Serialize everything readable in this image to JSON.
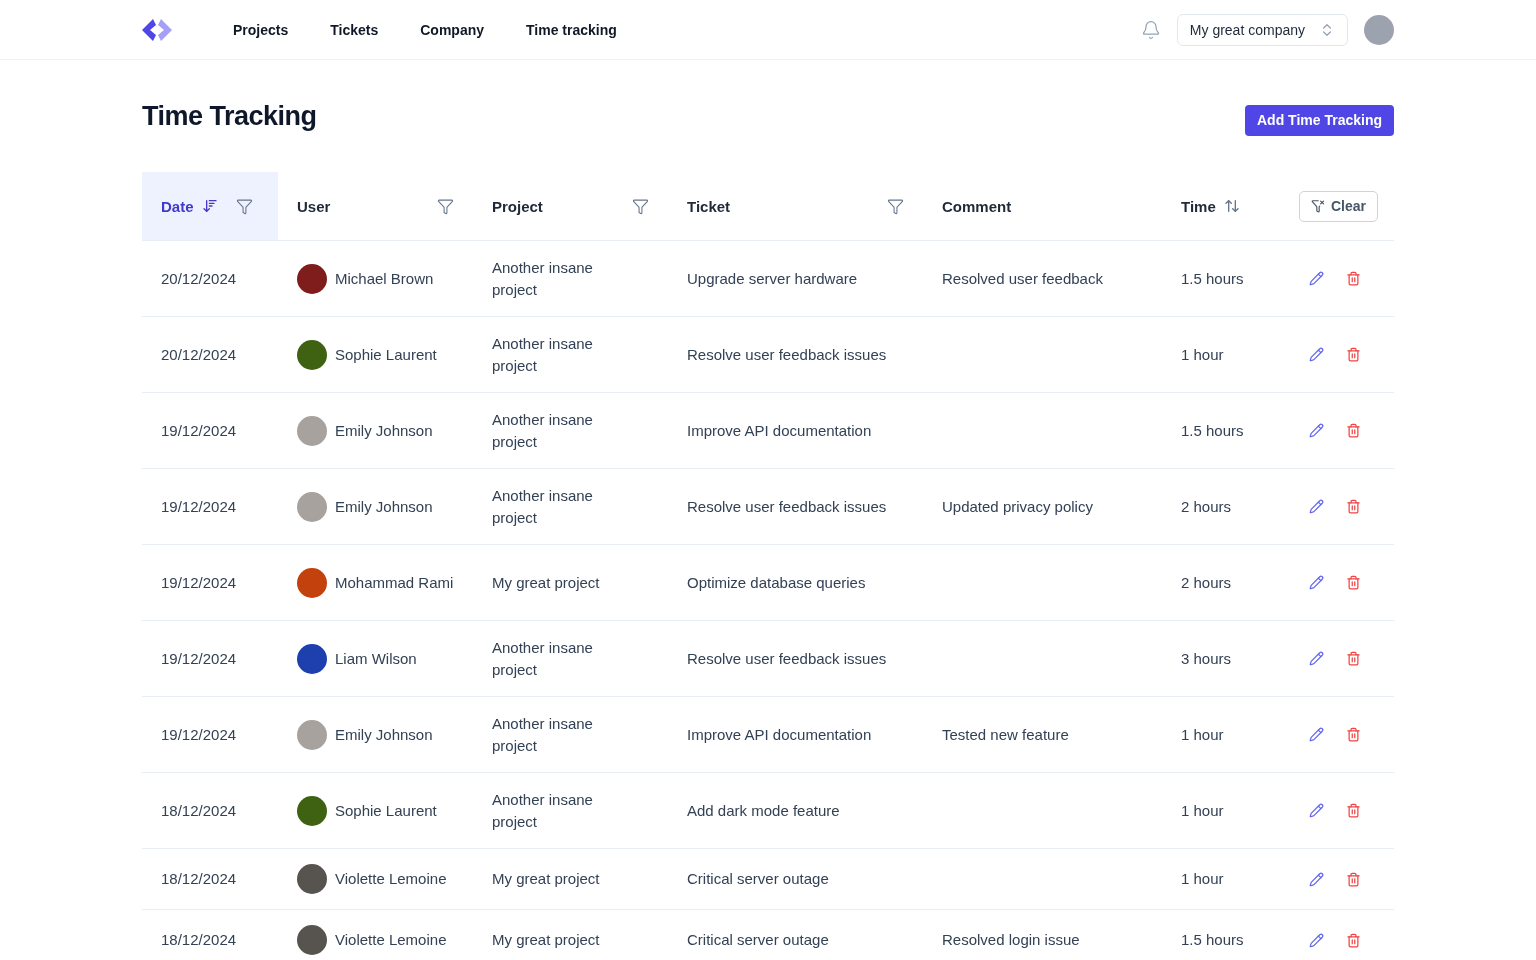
{
  "nav": {
    "items": [
      {
        "label": "Projects"
      },
      {
        "label": "Tickets"
      },
      {
        "label": "Company"
      },
      {
        "label": "Time tracking"
      }
    ],
    "company_select": {
      "value": "My great company"
    }
  },
  "page": {
    "title": "Time Tracking",
    "add_button": "Add Time Tracking"
  },
  "table": {
    "columns": [
      {
        "label": "Date",
        "selected": true,
        "sortable": true,
        "sorted": true,
        "filter": true
      },
      {
        "label": "User",
        "selected": false,
        "sortable": false,
        "filter": true
      },
      {
        "label": "Project",
        "selected": false,
        "sortable": false,
        "filter": true
      },
      {
        "label": "Ticket",
        "selected": false,
        "sortable": false,
        "filter": true
      },
      {
        "label": "Comment",
        "selected": false,
        "sortable": false,
        "filter": false
      },
      {
        "label": "Time",
        "selected": false,
        "sortable": true,
        "sorted": false,
        "filter": false
      }
    ],
    "clear_button": "Clear",
    "rows": [
      {
        "date": "20/12/2024",
        "user": "Michael Brown",
        "project": "Another insane project",
        "ticket": "Upgrade server hardware",
        "comment": "Resolved user feedback",
        "time": "1.5 hours"
      },
      {
        "date": "20/12/2024",
        "user": "Sophie Laurent",
        "project": "Another insane project",
        "ticket": "Resolve user feedback issues",
        "time": "1 hour"
      },
      {
        "date": "19/12/2024",
        "user": "Emily Johnson",
        "project": "Another insane project",
        "ticket": "Improve API documentation",
        "time": "1.5 hours"
      },
      {
        "date": "19/12/2024",
        "user": "Emily Johnson",
        "project": "Another insane project",
        "ticket": "Resolve user feedback issues",
        "comment": "Updated privacy policy",
        "time": "2 hours"
      },
      {
        "date": "19/12/2024",
        "user": "Mohammad Rami",
        "project": "My great project",
        "ticket": "Optimize database queries",
        "time": "2 hours"
      },
      {
        "date": "19/12/2024",
        "user": "Liam Wilson",
        "project": "Another insane project",
        "ticket": "Resolve user feedback issues",
        "time": "3 hours"
      },
      {
        "date": "19/12/2024",
        "user": "Emily Johnson",
        "project": "Another insane project",
        "ticket": "Improve API documentation",
        "comment": "Tested new feature",
        "time": "1 hour"
      },
      {
        "date": "18/12/2024",
        "user": "Sophie Laurent",
        "project": "Another insane project",
        "ticket": "Add dark mode feature",
        "time": "1 hour"
      },
      {
        "date": "18/12/2024",
        "user": "Violette Lemoine",
        "project": "My great project",
        "ticket": "Critical server outage",
        "time": "1 hour"
      },
      {
        "date": "18/12/2024",
        "user": "Violette Lemoine",
        "project": "My great project",
        "ticket": "Critical server outage",
        "comment": "Resolved login issue",
        "time": "1.5 hours"
      }
    ]
  }
}
